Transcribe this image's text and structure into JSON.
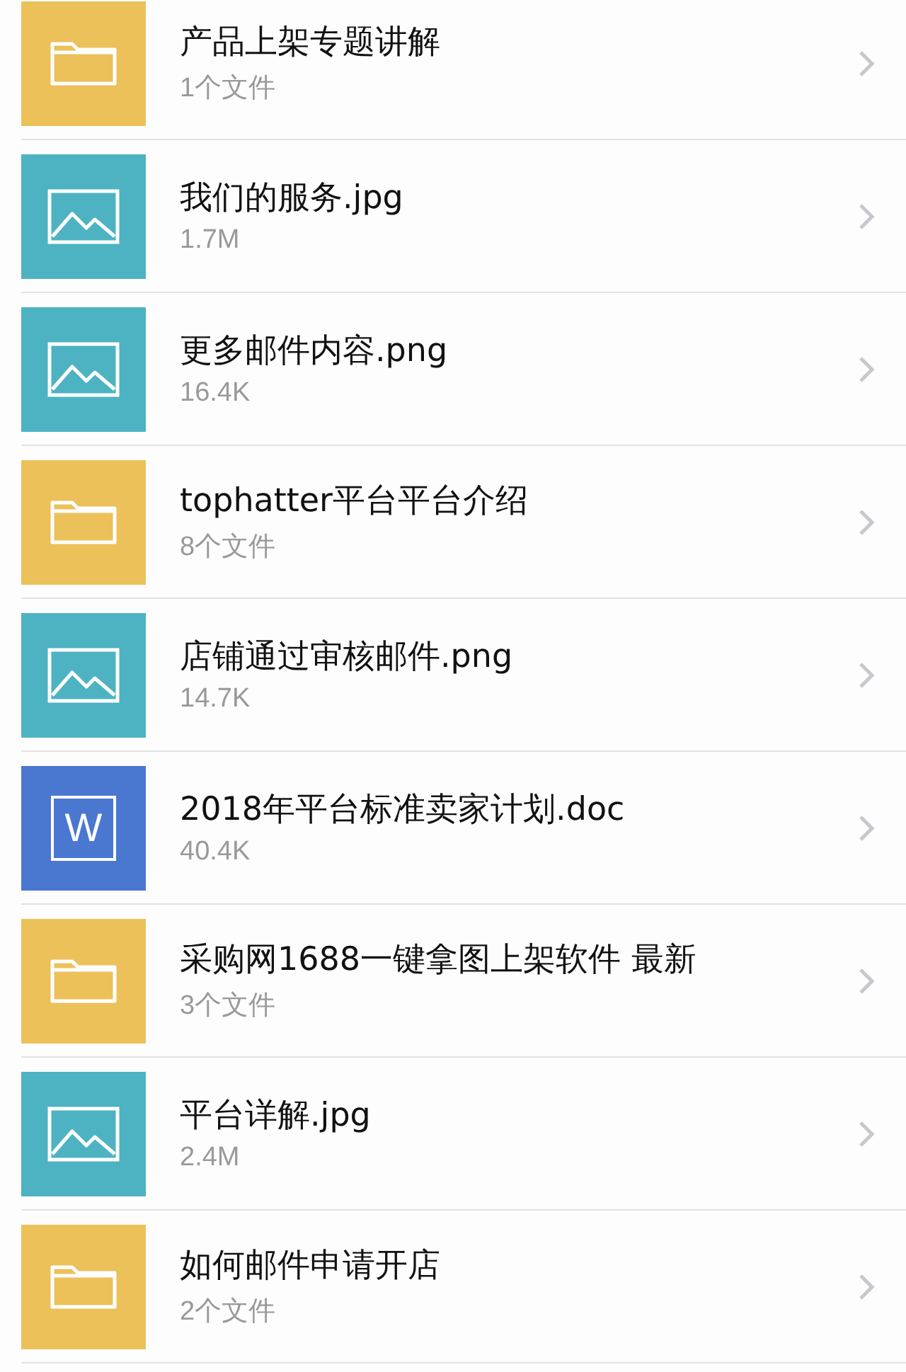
{
  "files": [
    {
      "kind": "folder",
      "name": "产品上架专题讲解",
      "detail": "1个文件"
    },
    {
      "kind": "image",
      "name": "我们的服务.jpg",
      "detail": "1.7M"
    },
    {
      "kind": "image",
      "name": "更多邮件内容.png",
      "detail": "16.4K"
    },
    {
      "kind": "folder",
      "name": "tophatter平台平台介绍",
      "detail": "8个文件"
    },
    {
      "kind": "image",
      "name": "店铺通过审核邮件.png",
      "detail": "14.7K"
    },
    {
      "kind": "doc",
      "name": "2018年平台标准卖家计划.doc",
      "detail": "40.4K",
      "badge": "W"
    },
    {
      "kind": "folder",
      "name": "采购网1688一键拿图上架软件 最新",
      "detail": "3个文件"
    },
    {
      "kind": "image",
      "name": "平台详解.jpg",
      "detail": "2.4M"
    },
    {
      "kind": "folder",
      "name": "如何邮件申请开店",
      "detail": "2个文件"
    }
  ]
}
